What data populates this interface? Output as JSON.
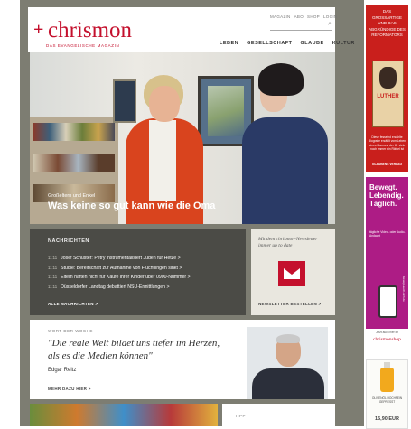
{
  "header": {
    "logo_mark": "+",
    "logo": "chrismon",
    "tagline": "DAS EVANGELISCHE MAGAZIN",
    "utility": [
      "MAGAZIN",
      "ABO",
      "SHOP",
      "LOGIN"
    ],
    "nav": [
      "LEBEN",
      "GESELLSCHAFT",
      "GLAUBE",
      "KULTUR"
    ]
  },
  "hero": {
    "kicker": "Großeltern und Enkel",
    "title": "Was keine so gut kann wie die Oma"
  },
  "news": {
    "heading": "NACHRICHTEN",
    "items": [
      {
        "time": "11:11",
        "text": "Josef Schuster: Petry instrumentalisiert Juden für Hetze >"
      },
      {
        "time": "11:11",
        "text": "Studie: Bereitschaft zur Aufnahme von Flüchtlingen sinkt >"
      },
      {
        "time": "11:11",
        "text": "Eltern haften nicht für Käufe ihrer Kinder über 0900-Nummer >"
      },
      {
        "time": "11:11",
        "text": "Düsseldorfer Landtag debattiert NSU-Ermittlungen >"
      }
    ],
    "all_link": "ALLE NACHRICHTEN >"
  },
  "newsletter": {
    "text": "Mit dem chrismon-Newsletter immer up to date",
    "button": "NEWSLETTER BESTELLEN >"
  },
  "quote": {
    "heading": "WORT DER WOCHE",
    "text": "\"Die reale Welt bildet uns tiefer im Herzen, als es die Medien können\"",
    "author": "Edgar Reitz",
    "more": "MEHR DAZU HIER >"
  },
  "tipp": {
    "heading": "TIPP"
  },
  "sidebar": {
    "ad1": {
      "lines": [
        "DAS",
        "GROSSARTIGE",
        "UND DAS",
        "ABGRÜNDIGE DES",
        "REFORMATORS"
      ],
      "book_title": "LUTHER",
      "small": "Diese fesselnd erzählte Biografie erzählt vom Leben eines Mannes, der für viele noch immer ein Rätsel ist",
      "publisher": "GLAUBENS VERLAG"
    },
    "ad2": {
      "title": "Bewegt. Lebendig. Täglich.",
      "sub": "tägliche Video- oder Audio-Andacht",
      "url": "bewegt-auch-dich.de",
      "shop_line": "Jetzt auch hier im",
      "shop": "chrismonshop"
    },
    "ad3": {
      "text": "OLIVENÖL HOCHFEIN GEPRESST",
      "price": "15,90 EUR"
    }
  },
  "colors": {
    "brand": "#c4102d",
    "page_bg": "#7d7d72",
    "news_bg": "#4b4b46"
  }
}
